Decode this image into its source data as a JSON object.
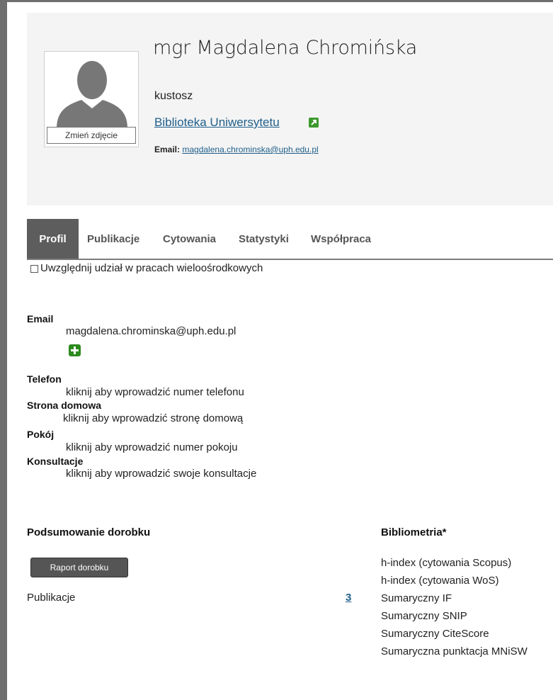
{
  "profile": {
    "name": "mgr Magdalena Chromińska",
    "position": "kustosz",
    "unit": "Biblioteka Uniwersytetu",
    "email_label": "Email:",
    "email": "magdalena.chrominska@uph.edu.pl",
    "change_photo": "Zmień zdjęcie"
  },
  "tabs": [
    {
      "label": "Profil",
      "active": true
    },
    {
      "label": "Publikacje"
    },
    {
      "label": "Cytowania"
    },
    {
      "label": "Statystyki"
    },
    {
      "label": "Współpraca"
    }
  ],
  "multicenter_checkbox": {
    "label": "Uwzględnij udział w pracach wieloośrodkowych",
    "checked": false
  },
  "contact": {
    "email_label": "Email",
    "email_value": "magdalena.chrominska@uph.edu.pl",
    "phone_label": "Telefon",
    "phone_value": "kliknij aby wprowadzić numer telefonu",
    "homepage_label": "Strona domowa",
    "homepage_value": "kliknij aby wprowadzić stronę domową",
    "room_label": "Pokój",
    "room_value": "kliknij aby wprowadzić numer pokoju",
    "consult_label": "Konsultacje",
    "consult_value": "kliknij aby wprowadzić swoje konsultacje"
  },
  "summary": {
    "title": "Podsumowanie dorobku",
    "report_button": "Raport dorobku",
    "publications_label": "Publikacje",
    "publications_count": "3"
  },
  "bibliometrics": {
    "title": "Bibliometria*",
    "items": [
      "h-index (cytowania Scopus)",
      "h-index (cytowania WoS)",
      "Sumaryczny IF",
      "Sumaryczny SNIP",
      "Sumaryczny CiteScore",
      "Sumaryczna punktacja MNiSW"
    ]
  },
  "colors": {
    "link": "#1f5f8b",
    "active_tab": "#5d5d5d",
    "add_icon": "#2d8a1f"
  },
  "icons": {
    "external_link": "external-link-icon",
    "add": "plus-icon",
    "avatar": "person-silhouette"
  }
}
